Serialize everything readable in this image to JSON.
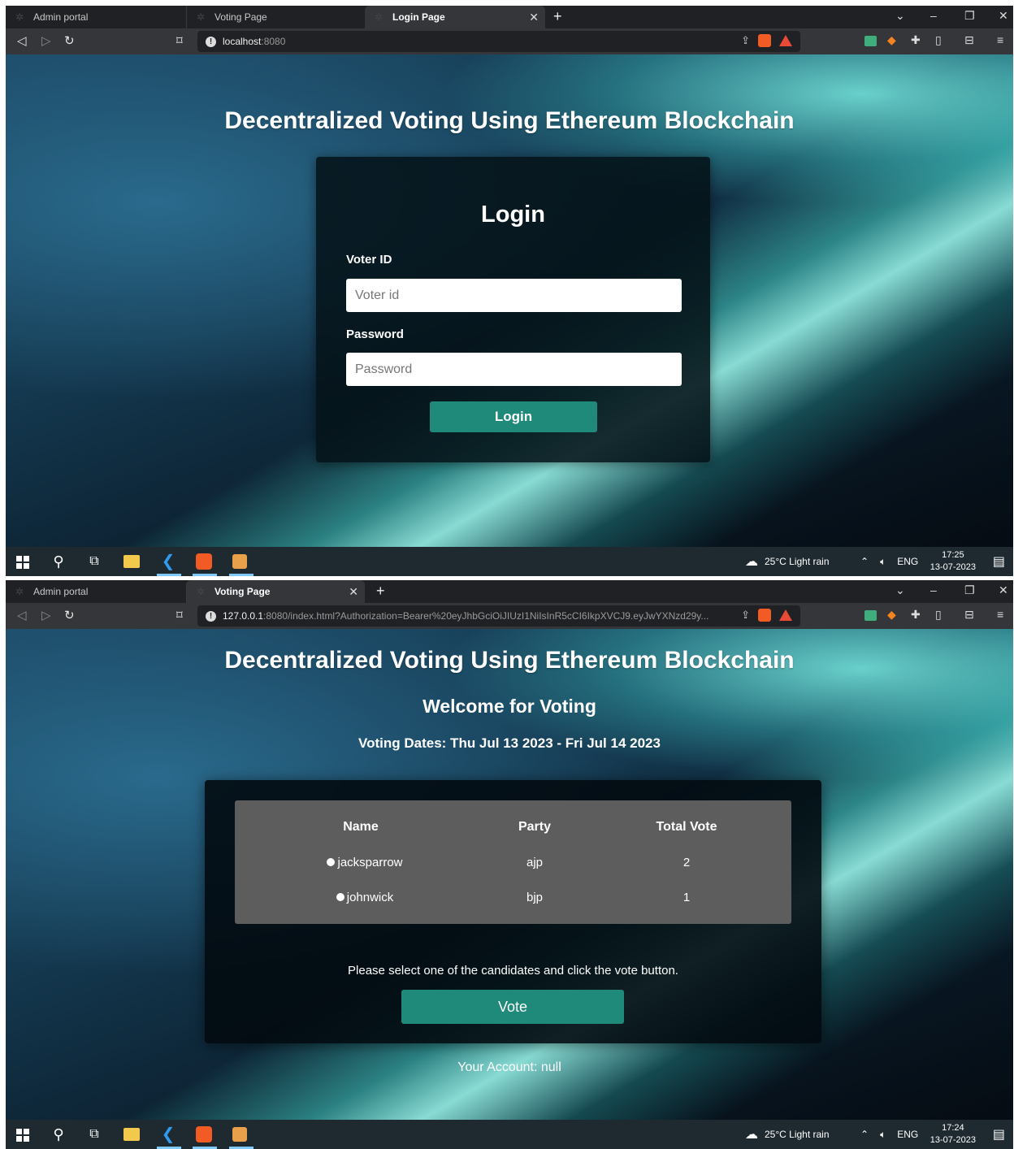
{
  "browser": {
    "tabs": [
      "Admin portal",
      "Voting Page",
      "Login Page"
    ],
    "tabs2": [
      "Admin portal",
      "Voting Page"
    ],
    "url1_host": "localhost",
    "url1_rest": ":8080",
    "url2_host": "127.0.0.1",
    "url2_rest": ":8080/index.html?Authorization=Bearer%20eyJhbGciOiJIUzI1NiIsInR5cCI6IkpXVCJ9.eyJwYXNzd29y..."
  },
  "app": {
    "title": "Decentralized Voting Using Ethereum Blockchain"
  },
  "login": {
    "heading": "Login",
    "voter_label": "Voter ID",
    "voter_placeholder": "Voter id",
    "password_label": "Password",
    "password_placeholder": "Password",
    "button": "Login"
  },
  "voting": {
    "welcome": "Welcome for Voting",
    "dates": "Voting Dates: Thu Jul 13 2023 - Fri Jul 14 2023",
    "columns": [
      "Name",
      "Party",
      "Total Vote"
    ],
    "candidates": [
      {
        "name": "jacksparrow",
        "party": "ajp",
        "votes": "2"
      },
      {
        "name": "johnwick",
        "party": "bjp",
        "votes": "1"
      }
    ],
    "instruction": "Please select one of the candidates and click the vote button.",
    "vote_button": "Vote",
    "account": "Your Account: null"
  },
  "taskbar": {
    "weather": "25°C  Light rain",
    "lang": "ENG",
    "time1": "17:25",
    "time2": "17:24",
    "date": "13-07-2023"
  },
  "colors": {
    "accent": "#1f8a7a",
    "table_bg": "#5d5d5d"
  }
}
